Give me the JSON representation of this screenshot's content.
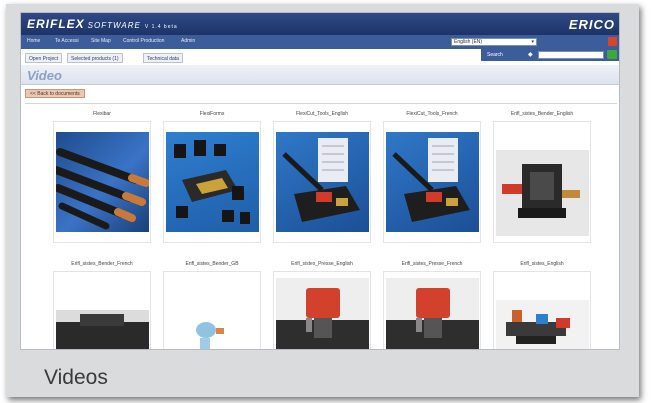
{
  "caption": "Videos",
  "app": {
    "logo": "ERIFLEX",
    "logo_suffix": "SOFTWARE",
    "version": "V 1.4 beta",
    "brand": "ERICO"
  },
  "nav": {
    "items": [
      "Home",
      "Te Accessi",
      "Site Map",
      "Control Production",
      "Admin"
    ],
    "language_select": "English (EN)"
  },
  "search": {
    "label": "Search",
    "placeholder": ""
  },
  "tabs": [
    "Open Project",
    "Selected products (1)",
    "Technical data"
  ],
  "page": {
    "title": "Video",
    "back_label": "<< Back to documents"
  },
  "gallery": {
    "items": [
      {
        "label": "Flexibar"
      },
      {
        "label": "FlexiForms"
      },
      {
        "label": "FlexiCut_Tools_English"
      },
      {
        "label": "FlexiCut_Tools_French"
      },
      {
        "label": "Erifl_sistes_Bender_English"
      },
      {
        "label": "Erifl_sistes_Bender_French"
      },
      {
        "label": "Erifl_sistes_Bender_GB"
      },
      {
        "label": "Erifl_sistes_Presse_English"
      },
      {
        "label": "Erifl_sistes_Presse_French"
      },
      {
        "label": "Erifl_sistes_English"
      }
    ]
  },
  "colors": {
    "header": "#1c3468",
    "nav": "#3d5c9a",
    "accent_red": "#d8452c",
    "accent_green": "#3fa83a",
    "title": "#8aa0c8"
  }
}
